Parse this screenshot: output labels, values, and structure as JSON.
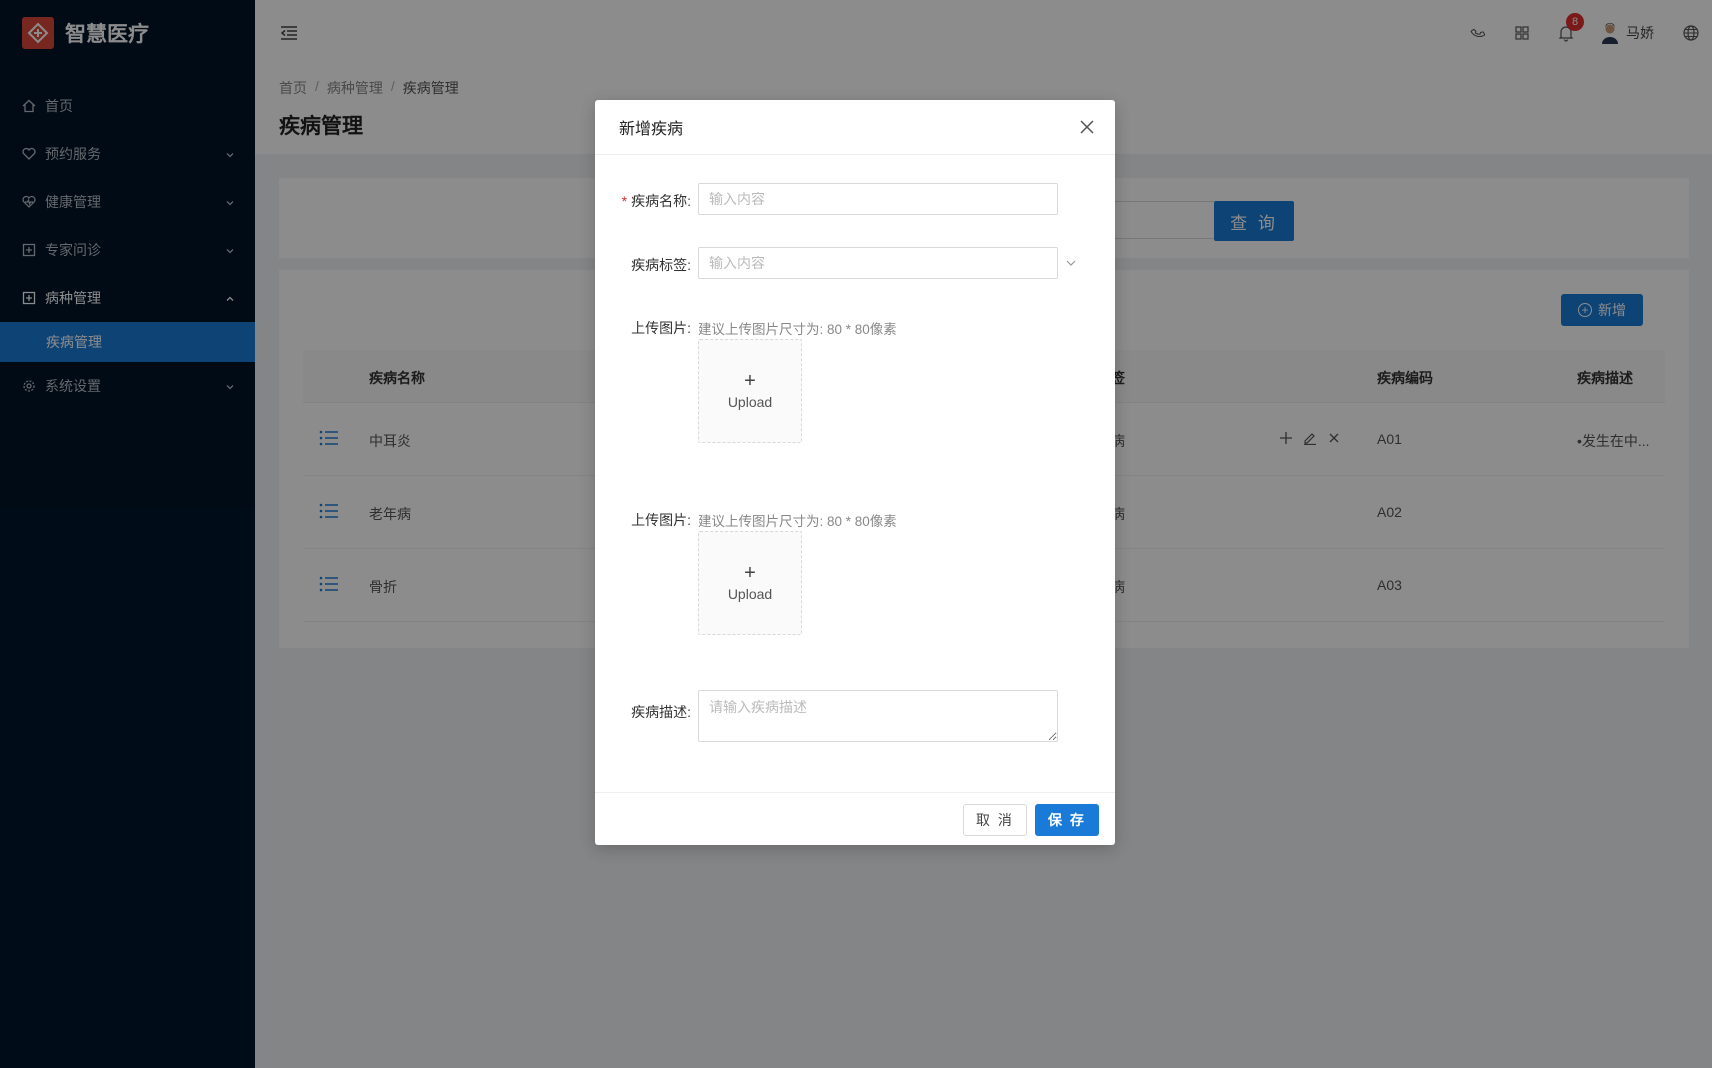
{
  "app": {
    "title": "智慧医疗"
  },
  "colors": {
    "primary": "#1a7ad8",
    "sidebar_bg": "#001529",
    "danger": "#e02d2d"
  },
  "sidebar": {
    "items": [
      {
        "label": "首页",
        "icon": "home-icon"
      },
      {
        "label": "预约服务",
        "icon": "heart-icon"
      },
      {
        "label": "健康管理",
        "icon": "heartbeat-icon"
      },
      {
        "label": "专家问诊",
        "icon": "medical-box-icon"
      },
      {
        "label": "病种管理",
        "icon": "medical-box-icon",
        "expanded": true,
        "children": [
          {
            "label": "疾病管理",
            "active": true
          }
        ]
      },
      {
        "label": "系统设置",
        "icon": "gear-icon"
      }
    ]
  },
  "topbar": {
    "notifications_count": "8",
    "username": "马娇"
  },
  "breadcrumb": [
    "首页",
    "病种管理",
    "疾病管理"
  ],
  "page": {
    "title": "疾病管理"
  },
  "search": {
    "button_label": "查 询"
  },
  "table": {
    "add_label": "新增",
    "headers": {
      "name": "疾病名称",
      "tag_partial": "签",
      "code": "疾病编码",
      "desc": "疾病描述"
    },
    "rows": [
      {
        "name": "中耳炎",
        "tag_partial": "病",
        "code": "A01",
        "desc": "•发生在中..."
      },
      {
        "name": "老年病",
        "tag_partial": "病",
        "code": "A02",
        "desc": ""
      },
      {
        "name": "骨折",
        "tag_partial": "病",
        "code": "A03",
        "desc": ""
      }
    ]
  },
  "modal": {
    "title": "新增疾病",
    "name_label": "疾病名称:",
    "name_placeholder": "输入内容",
    "tag_label": "疾病标签:",
    "tag_placeholder": "输入内容",
    "upload1_label": "上传图片:",
    "upload1_hint": "建议上传图片尺寸为: 80 * 80像素",
    "upload1_text": "Upload",
    "upload2_label": "上传图片:",
    "upload2_hint": "建议上传图片尺寸为: 80 * 80像素",
    "upload2_text": "Upload",
    "desc_label": "疾病描述:",
    "desc_placeholder": "请输入疾病描述",
    "cancel_label": "取 消",
    "save_label": "保 存"
  }
}
